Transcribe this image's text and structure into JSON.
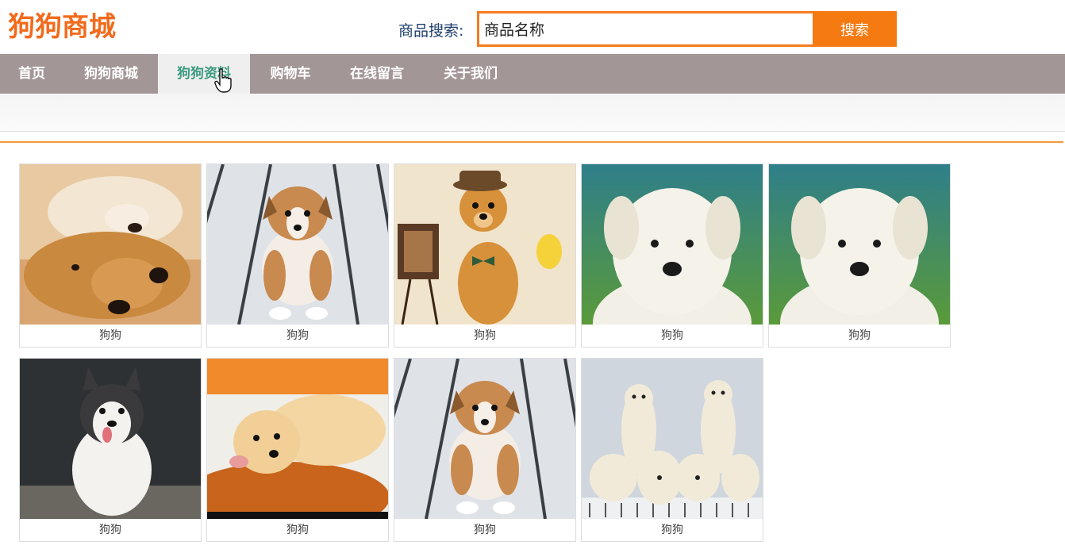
{
  "header": {
    "logo": "狗狗商城",
    "search_label": "商品搜索:",
    "search_value": "商品名称",
    "search_button": "搜索"
  },
  "nav": {
    "items": [
      {
        "label": "首页",
        "active": false
      },
      {
        "label": "狗狗商城",
        "active": false
      },
      {
        "label": "狗狗资料",
        "active": true
      },
      {
        "label": "购物车",
        "active": false
      },
      {
        "label": "在线留言",
        "active": false
      },
      {
        "label": "关于我们",
        "active": false
      }
    ]
  },
  "products": [
    {
      "caption": "狗狗",
      "image": "two-golden-retrievers-lying"
    },
    {
      "caption": "狗狗",
      "image": "corgi-puppy-white-floor"
    },
    {
      "caption": "狗狗",
      "image": "golden-puppy-with-hat"
    },
    {
      "caption": "狗狗",
      "image": "white-labrador-puppy-green"
    },
    {
      "caption": "狗狗",
      "image": "white-labrador-puppy-green"
    },
    {
      "caption": "狗狗",
      "image": "husky-puppy-dark"
    },
    {
      "caption": "狗狗",
      "image": "golden-puppy-orange-chair"
    },
    {
      "caption": "狗狗",
      "image": "corgi-puppy-white-floor"
    },
    {
      "caption": "狗狗",
      "image": "labrador-puppy-group"
    }
  ],
  "colors": {
    "brand": "#f26b1d",
    "nav_bg": "#a39696",
    "nav_active_text": "#3a9a7f",
    "search_border": "#f57c1f"
  }
}
